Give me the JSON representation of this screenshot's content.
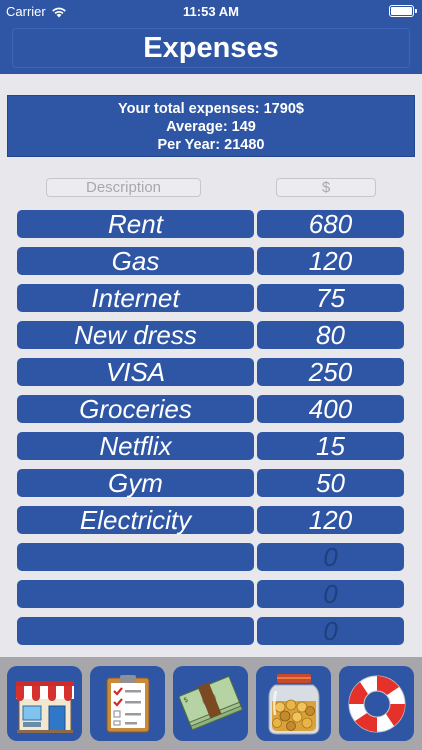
{
  "status_bar": {
    "carrier": "Carrier",
    "time": "11:53 AM"
  },
  "header": {
    "title": "Expenses"
  },
  "summary": {
    "total": "Your total expenses: 1790$",
    "average": "Average: 149",
    "per_year": "Per Year: 21480"
  },
  "inputs": {
    "description_placeholder": "Description",
    "amount_placeholder": "$"
  },
  "expenses": [
    {
      "name": "Rent",
      "amount": "680"
    },
    {
      "name": "Gas",
      "amount": "120"
    },
    {
      "name": "Internet",
      "amount": "75"
    },
    {
      "name": "New dress",
      "amount": "80"
    },
    {
      "name": "VISA",
      "amount": "250"
    },
    {
      "name": "Groceries",
      "amount": "400"
    },
    {
      "name": "Netflix",
      "amount": "15"
    },
    {
      "name": "Gym",
      "amount": "50"
    },
    {
      "name": "Electricity",
      "amount": "120"
    },
    {
      "name": "",
      "amount": "0"
    },
    {
      "name": "",
      "amount": "0"
    },
    {
      "name": "",
      "amount": "0"
    }
  ],
  "tabs": [
    {
      "icon": "store-icon"
    },
    {
      "icon": "checklist-icon"
    },
    {
      "icon": "money-icon"
    },
    {
      "icon": "coin-jar-icon"
    },
    {
      "icon": "lifebuoy-icon"
    }
  ],
  "colors": {
    "primary": "#2e56a5",
    "background": "#e8e8ec",
    "tabbar": "#a7a7ab"
  }
}
